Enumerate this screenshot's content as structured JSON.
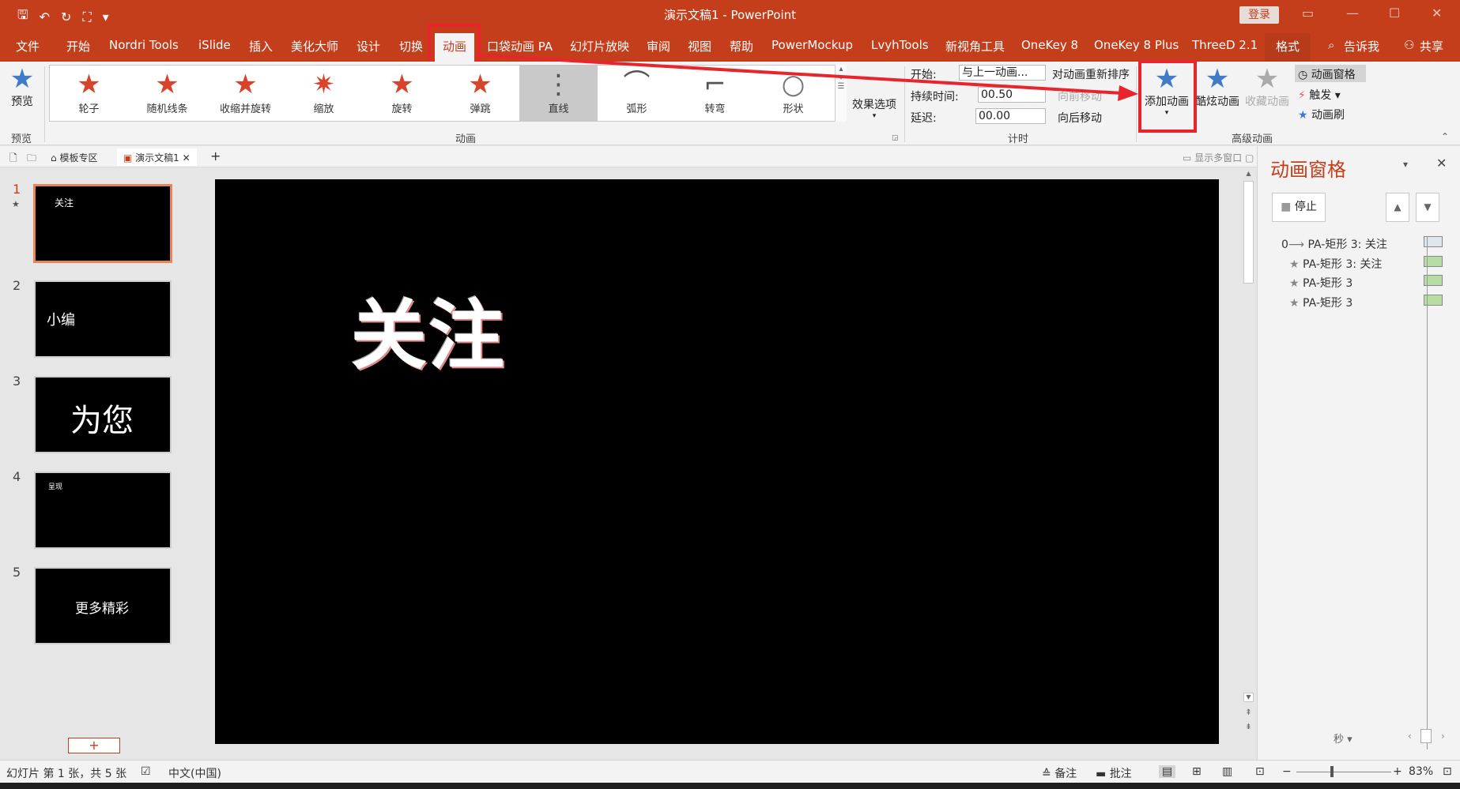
{
  "window": {
    "title": "演示文稿1  -  PowerPoint",
    "login": "登录"
  },
  "qat": {
    "save": "🖫",
    "undo": "↶",
    "redo": "↻",
    "present": "⛶",
    "more": "▾"
  },
  "tabs": [
    {
      "label": "文件"
    },
    {
      "label": "开始"
    },
    {
      "label": "Nordri Tools"
    },
    {
      "label": "iSlide"
    },
    {
      "label": "插入"
    },
    {
      "label": "美化大师"
    },
    {
      "label": "设计"
    },
    {
      "label": "切换"
    },
    {
      "label": "动画"
    },
    {
      "label": "口袋动画 PA"
    },
    {
      "label": "幻灯片放映"
    },
    {
      "label": "审阅"
    },
    {
      "label": "视图"
    },
    {
      "label": "帮助"
    },
    {
      "label": "PowerMockup"
    },
    {
      "label": "LvyhTools"
    },
    {
      "label": "新视角工具"
    },
    {
      "label": "OneKey 8"
    },
    {
      "label": "OneKey 8 Plus"
    },
    {
      "label": "ThreeD 2.1"
    },
    {
      "label": "格式"
    }
  ],
  "tellme": "告诉我",
  "share": "共享",
  "ribbon": {
    "preview": {
      "label": "预览",
      "group": "预览"
    },
    "effects": [
      {
        "label": "轮子",
        "icon": "★"
      },
      {
        "label": "随机线条",
        "icon": "★"
      },
      {
        "label": "收缩并旋转",
        "icon": "★"
      },
      {
        "label": "缩放",
        "icon": "✷"
      },
      {
        "label": "旋转",
        "icon": "★"
      },
      {
        "label": "弹跳",
        "icon": "★"
      },
      {
        "label": "直线",
        "icon": "⋮"
      },
      {
        "label": "弧形",
        "icon": "⌒"
      },
      {
        "label": "转弯",
        "icon": "⌐"
      },
      {
        "label": "形状",
        "icon": "○"
      }
    ],
    "effect_options": "效果选项",
    "anim_group": "动画",
    "timing": {
      "start_label": "开始:",
      "start_value": "与上一动画...",
      "duration_label": "持续时间:",
      "duration_value": "00.50",
      "delay_label": "延迟:",
      "delay_value": "00.00",
      "reorder": "对动画重新排序",
      "forward": "向前移动",
      "backward": "向后移动",
      "group": "计时"
    },
    "advanced": {
      "add": "添加动画",
      "cool": "酷炫动画",
      "fav": "收藏动画",
      "pane": "动画窗格",
      "trigger": "触发",
      "painter": "动画刷",
      "group": "高级动画"
    }
  },
  "docbar": {
    "template": "模板专区",
    "doc": "演示文稿1",
    "multiwin": "显示多窗口"
  },
  "slides": [
    {
      "num": "1",
      "text": "关注"
    },
    {
      "num": "2",
      "text": "小编"
    },
    {
      "num": "3",
      "text": "为您"
    },
    {
      "num": "4",
      "text": "呈现"
    },
    {
      "num": "5",
      "text": "更多精彩"
    }
  ],
  "main_text": "关注",
  "anim_pane": {
    "title": "动画窗格",
    "stop": "停止",
    "items": [
      {
        "num": "0",
        "icon": "⟶",
        "label": "PA-矩形 3: 关注"
      },
      {
        "num": "",
        "icon": "★",
        "label": "PA-矩形 3: 关注"
      },
      {
        "num": "",
        "icon": "★",
        "label": "PA-矩形 3"
      },
      {
        "num": "",
        "icon": "★",
        "label": "PA-矩形 3"
      }
    ],
    "seconds": "秒"
  },
  "status": {
    "slide_info": "幻灯片 第 1 张，共 5 张",
    "language": "中文(中国)",
    "notes": "备注",
    "comments": "批注",
    "zoom": "83%"
  }
}
